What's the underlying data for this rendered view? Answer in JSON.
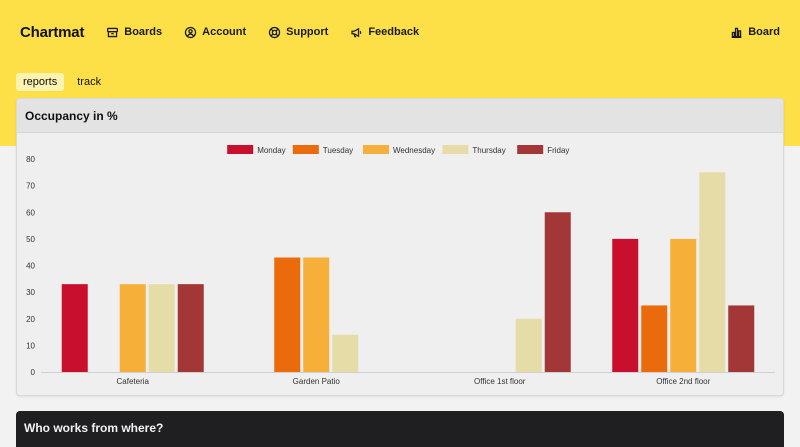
{
  "app": {
    "brand": "Chartmat"
  },
  "nav": {
    "items": [
      {
        "label": "Boards",
        "icon": "archive-icon"
      },
      {
        "label": "Account",
        "icon": "user-circle-icon"
      },
      {
        "label": "Support",
        "icon": "lifebuoy-icon"
      },
      {
        "label": "Feedback",
        "icon": "megaphone-icon"
      }
    ],
    "right": {
      "label": "Board",
      "icon": "bar-chart-icon"
    }
  },
  "tabs": [
    {
      "label": "reports",
      "active": true
    },
    {
      "label": "track",
      "active": false
    }
  ],
  "cards": {
    "occupancy": {
      "title": "Occupancy in %"
    },
    "who_works": {
      "title": "Who works from where?"
    }
  },
  "colors": {
    "header_bg": "#fde047",
    "Monday": "#c8102e",
    "Tuesday": "#ea6a0c",
    "Wednesday": "#f6b03a",
    "Thursday": "#e6dca8",
    "Friday": "#a33737"
  },
  "chart_data": {
    "type": "bar",
    "title": "",
    "categories": [
      "Cafeteria",
      "Garden Patio",
      "Office 1st floor",
      "Office 2nd floor"
    ],
    "series": [
      {
        "name": "Monday",
        "values": [
          33,
          0,
          0,
          50
        ]
      },
      {
        "name": "Tuesday",
        "values": [
          0,
          43,
          0,
          25
        ]
      },
      {
        "name": "Wednesday",
        "values": [
          33,
          43,
          0,
          50
        ]
      },
      {
        "name": "Thursday",
        "values": [
          33,
          14,
          20,
          75
        ]
      },
      {
        "name": "Friday",
        "values": [
          33,
          0,
          60,
          25
        ]
      }
    ],
    "ylim": [
      0,
      80
    ],
    "yticks": [
      0,
      10,
      20,
      30,
      40,
      50,
      60,
      70,
      80
    ],
    "legend": "top-center",
    "grid": false
  }
}
